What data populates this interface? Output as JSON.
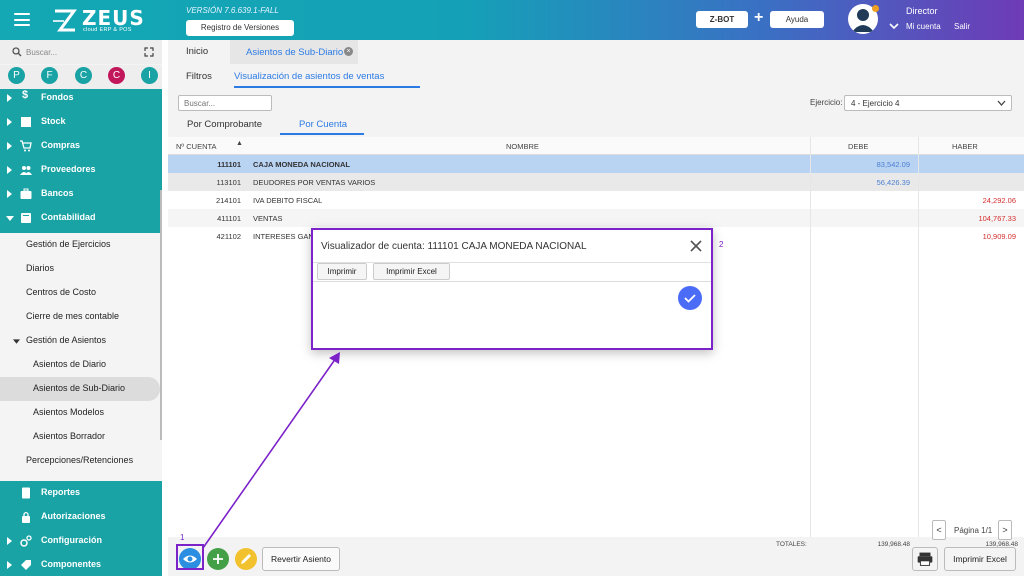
{
  "header": {
    "logo_text": "ZEUS",
    "logo_sub": "cloud ERP & POS",
    "version": "VERSIÓN 7.6.639.1-FALL",
    "versions_button": "Registro de Versiones",
    "zbot_button": "Z-BOT",
    "help_button": "Ayuda",
    "user_name": "Director",
    "my_account": "Mi cuenta",
    "exit": "Salir"
  },
  "sidebar": {
    "search_placeholder": "Buscar...",
    "quick_circles": [
      {
        "letter": "P",
        "color": "#1aa3a5"
      },
      {
        "letter": "F",
        "color": "#1aa3a5"
      },
      {
        "letter": "C",
        "color": "#1aa3a5"
      },
      {
        "letter": "C",
        "color": "#c2185b"
      },
      {
        "letter": "I",
        "color": "#1aa3a5"
      }
    ],
    "top_items": [
      "Fondos",
      "Stock",
      "Compras",
      "Proveedores",
      "Bancos",
      "Contabilidad"
    ],
    "sub_items": [
      "Gestión de Ejercicios",
      "Diarios",
      "Centros de Costo",
      "Cierre de mes contable",
      "Gestión de Asientos"
    ],
    "sub_sub_items": [
      "Asientos de Diario",
      "Asientos de Sub-Diario",
      "Asientos Modelos",
      "Asientos Borrador"
    ],
    "percepciones": "Percepciones/Retenciones",
    "bottom_items": [
      "Reportes",
      "Autorizaciones",
      "Configuración",
      "Componentes"
    ]
  },
  "tabs": {
    "home": "Inicio",
    "active": "Asientos de Sub-Diario"
  },
  "subtabs": {
    "filters": "Filtros",
    "visualization": "Visualización de asientos de ventas"
  },
  "toolbar": {
    "search_placeholder": "Buscar...",
    "exercise_label": "Ejercicio:",
    "exercise_value": "4 - Ejercicio 4"
  },
  "view_tabs": {
    "by_voucher": "Por Comprobante",
    "by_account": "Por Cuenta"
  },
  "grid": {
    "headers": {
      "account": "Nº CUENTA",
      "name": "NOMBRE",
      "debit": "DEBE",
      "credit": "HABER"
    },
    "rows": [
      {
        "account": "111101",
        "name": "CAJA MONEDA NACIONAL",
        "debit": "83,542.09",
        "credit": ""
      },
      {
        "account": "113101",
        "name": "DEUDORES POR VENTAS VARIOS",
        "debit": "56,426.39",
        "credit": ""
      },
      {
        "account": "214101",
        "name": "IVA DEBITO FISCAL",
        "debit": "",
        "credit": "24,292.06"
      },
      {
        "account": "411101",
        "name": "VENTAS",
        "debit": "",
        "credit": "104,767.33"
      },
      {
        "account": "421102",
        "name": "INTERESES GAN",
        "debit": "",
        "credit": "10,909.09"
      }
    ],
    "totals_label": "TOTALES:",
    "total_debit": "139,968.48",
    "total_credit": "139,968.48"
  },
  "pager": {
    "prev": "<",
    "text": "Página 1/1",
    "next": ">"
  },
  "actions": {
    "revert": "Revertir Asiento",
    "export_excel": "Imprimir Excel"
  },
  "modal": {
    "title": "Visualizador de cuenta: 111101 CAJA MONEDA NACIONAL",
    "print": "Imprimir",
    "print_excel": "Imprimir Excel"
  },
  "steps": {
    "one": "1",
    "two": "2"
  }
}
